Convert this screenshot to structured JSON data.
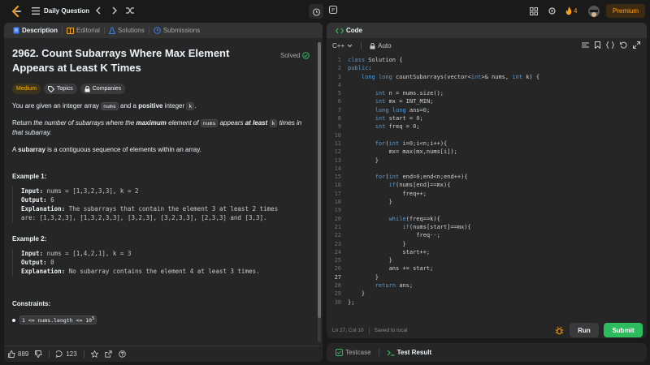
{
  "topbar": {
    "title": "Daily Question",
    "streak_count": "4",
    "premium_label": "Premium"
  },
  "left_tabs": [
    {
      "label": "Description"
    },
    {
      "label": "Editorial"
    },
    {
      "label": "Solutions"
    },
    {
      "label": "Submissions"
    }
  ],
  "problem": {
    "title": "2962. Count Subarrays Where Max Element Appears at Least K Times",
    "status": "Solved",
    "difficulty": "Medium",
    "topics_label": "Topics",
    "companies_label": "Companies",
    "p1_a": "You are given an integer array ",
    "p1_code": "nums",
    "p1_b": " and a ",
    "p1_bold": "positive",
    "p1_c": " integer ",
    "p1_code2": "k",
    "p1_d": ".",
    "p2_a": "Return ",
    "p2_i1": "the number of subarrays where the ",
    "p2_bold": "maximum",
    "p2_i2": " element of ",
    "p2_code": "nums",
    "p2_i3": " appears ",
    "p2_bold2": "at least",
    "p2_code2": "k",
    "p2_i4": " times in that subarray.",
    "p3_a": "A ",
    "p3_bold": "subarray",
    "p3_b": " is a contiguous sequence of elements within an array.",
    "examples": [
      {
        "title": "Example 1:",
        "input_label": "Input:",
        "input": " nums = [1,3,2,3,3], k = 2",
        "output_label": "Output:",
        "output": " 6",
        "explanation_label": "Explanation:",
        "explanation_l1": " The subarrays that contain the element 3 at least 2 times",
        "explanation_l2": "are: [1,3,2,3], [1,3,2,3,3], [3,2,3], [3,2,3,3], [2,3,3] and [3,3]."
      },
      {
        "title": "Example 2:",
        "input_label": "Input:",
        "input": " nums = [1,4,2,1], k = 3",
        "output_label": "Output:",
        "output": " 0",
        "explanation_label": "Explanation:",
        "explanation_l1": " No subarray contains the element 4 at least 3 times."
      }
    ],
    "constraints_title": "Constraints:",
    "constraint_1": "1 <= nums.length <= 10",
    "constraint_1_sup": "5"
  },
  "left_footer": {
    "likes": "889",
    "comments": "123"
  },
  "code_panel": {
    "header": "Code",
    "language": "C++",
    "mode": "Auto",
    "lines": [
      {
        "n": "1",
        "t": "class Solution {"
      },
      {
        "n": "2",
        "t": "public:"
      },
      {
        "n": "3",
        "t": "    long long countSubarrays(vector<int>& nums, int k) {"
      },
      {
        "n": "4",
        "t": ""
      },
      {
        "n": "5",
        "t": "        int n = nums.size();"
      },
      {
        "n": "6",
        "t": "        int mx = INT_MIN;"
      },
      {
        "n": "7",
        "t": "        long long ans=0;"
      },
      {
        "n": "8",
        "t": "        int start = 0;"
      },
      {
        "n": "9",
        "t": "        int freq = 0;"
      },
      {
        "n": "10",
        "t": ""
      },
      {
        "n": "11",
        "t": "        for(int i=0;i<n;i++){"
      },
      {
        "n": "12",
        "t": "            mx= max(mx,nums[i]);"
      },
      {
        "n": "13",
        "t": "        }"
      },
      {
        "n": "14",
        "t": ""
      },
      {
        "n": "15",
        "t": "        for(int end=0;end<n;end++){"
      },
      {
        "n": "16",
        "t": "            if(nums[end]==mx){"
      },
      {
        "n": "17",
        "t": "                freq++;"
      },
      {
        "n": "18",
        "t": "            }"
      },
      {
        "n": "19",
        "t": ""
      },
      {
        "n": "20",
        "t": "            while(freq==k){"
      },
      {
        "n": "21",
        "t": "                if(nums[start]==mx){"
      },
      {
        "n": "22",
        "t": "                    freq--;"
      },
      {
        "n": "23",
        "t": "                }"
      },
      {
        "n": "24",
        "t": "                start++;"
      },
      {
        "n": "25",
        "t": "            }"
      },
      {
        "n": "26",
        "t": "            ans += start;"
      },
      {
        "n": "27",
        "t": "        }"
      },
      {
        "n": "28",
        "t": "        return ans;"
      },
      {
        "n": "29",
        "t": "    }"
      },
      {
        "n": "30",
        "t": "};"
      }
    ],
    "cursor": "Ln 27, Col 10",
    "saved": "Saved to local",
    "run_label": "Run",
    "submit_label": "Submit"
  },
  "bottom_tabs": {
    "testcase": "Testcase",
    "result": "Test Result"
  },
  "colors": {
    "accent_orange": "#ffa116",
    "submit_green": "#2cbb5d",
    "medium_yellow": "#ffb800"
  }
}
